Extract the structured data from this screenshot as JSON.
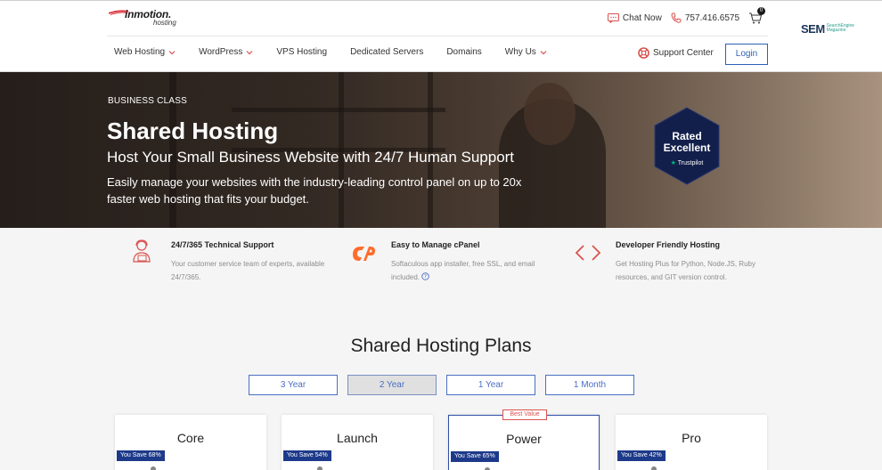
{
  "header": {
    "logo_brand": "inmotion.",
    "logo_sub": "hosting",
    "chat_label": "Chat Now",
    "phone": "757.416.6575",
    "cart_count": "0",
    "nav": [
      {
        "label": "Web Hosting",
        "has_menu": true
      },
      {
        "label": "WordPress",
        "has_menu": true
      },
      {
        "label": "VPS Hosting",
        "has_menu": false
      },
      {
        "label": "Dedicated Servers",
        "has_menu": false
      },
      {
        "label": "Domains",
        "has_menu": false
      },
      {
        "label": "Why Us",
        "has_menu": true
      }
    ],
    "support_label": "Support Center",
    "login_label": "Login",
    "sem_logo": "SEM",
    "sem_small_1": "SearchEngine",
    "sem_small_2": "Magazine"
  },
  "hero": {
    "kicker": "BUSINESS CLASS",
    "title": "Shared Hosting",
    "subtitle": "Host Your Small Business Website with 24/7 Human Support",
    "description": "Easily manage your websites with the industry-leading control panel on up to 20x faster web hosting that fits your budget.",
    "badge_line1": "Rated",
    "badge_line2": "Excellent",
    "badge_trustpilot": "Trustpilot"
  },
  "features": [
    {
      "icon": "support-agent-icon",
      "title": "24/7/365 Technical Support",
      "description": "Your customer service team of experts, available 24/7/365."
    },
    {
      "icon": "cpanel-icon",
      "title": "Easy to Manage cPanel",
      "description": "Softaculous app installer, free SSL, and email included."
    },
    {
      "icon": "code-icon",
      "title": "Developer Friendly Hosting",
      "description": "Get Hosting Plus for Python, Node.JS, Ruby resources, and GIT version control."
    }
  ],
  "plans": {
    "title": "Shared Hosting Plans",
    "terms": [
      "3 Year",
      "2 Year",
      "1 Year",
      "1 Month"
    ],
    "active_term": "2 Year",
    "best_value_label": "Best Value",
    "cards": [
      {
        "name": "Core",
        "savings": "You Save 68%"
      },
      {
        "name": "Launch",
        "savings": "You Save 54%"
      },
      {
        "name": "Power",
        "savings": "You Save 65%"
      },
      {
        "name": "Pro",
        "savings": "You Save 42%"
      }
    ]
  },
  "colors": {
    "accent_blue": "#2f5fb3",
    "accent_red": "#d9534f",
    "savings_badge": "#1d3a8a",
    "badge_navy": "#131f4b"
  }
}
